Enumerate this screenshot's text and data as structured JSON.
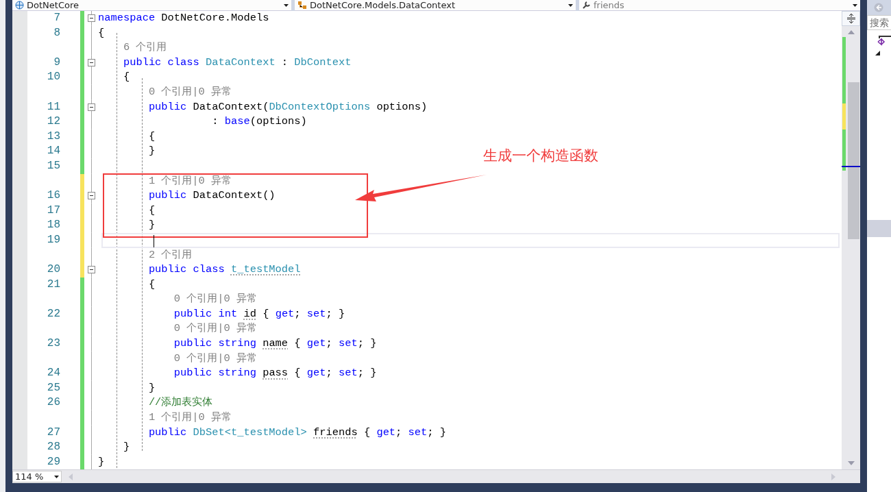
{
  "navigation_bar": [
    {
      "text": "DotNetCore",
      "dimmed": false
    },
    {
      "text": "DotNetCore.Models.DataContext",
      "dimmed": false
    },
    {
      "text": "friends",
      "dimmed": true
    }
  ],
  "lines": [
    {
      "kind": "code",
      "number": "7",
      "unsaved": false,
      "fold": true,
      "tokens": [
        {
          "kind": "keyword",
          "text": "namespace"
        },
        {
          "kind": "plain",
          "text": " DotNetCore.Models"
        }
      ]
    },
    {
      "kind": "code",
      "number": "8",
      "unsaved": false,
      "fold": false,
      "tokens": [
        {
          "kind": "plain",
          "text": "{"
        }
      ]
    },
    {
      "kind": "lens",
      "unsaved": false,
      "tokens": [
        {
          "kind": "lens",
          "text": "    6 个引用"
        }
      ]
    },
    {
      "kind": "code",
      "number": "9",
      "unsaved": false,
      "fold": true,
      "tokens": [
        {
          "kind": "keyword",
          "text": "    public class"
        },
        {
          "kind": "type",
          "text": " DataContext"
        },
        {
          "kind": "plain",
          "text": " : "
        },
        {
          "kind": "type",
          "text": "DbContext"
        }
      ]
    },
    {
      "kind": "code",
      "number": "10",
      "unsaved": false,
      "fold": false,
      "tokens": [
        {
          "kind": "plain",
          "text": "    {"
        }
      ]
    },
    {
      "kind": "lens",
      "unsaved": false,
      "tokens": [
        {
          "kind": "lens",
          "text": "        0 个引用|0 异常"
        }
      ]
    },
    {
      "kind": "code",
      "number": "11",
      "unsaved": false,
      "fold": true,
      "tokens": [
        {
          "kind": "keyword",
          "text": "        public"
        },
        {
          "kind": "plain",
          "text": " DataContext("
        },
        {
          "kind": "type",
          "text": "DbContextOptions"
        },
        {
          "kind": "plain",
          "text": " options)"
        }
      ]
    },
    {
      "kind": "code",
      "number": "12",
      "unsaved": false,
      "fold": false,
      "tokens": [
        {
          "kind": "plain",
          "text": "                  : "
        },
        {
          "kind": "keyword",
          "text": "base"
        },
        {
          "kind": "plain",
          "text": "(options)"
        }
      ]
    },
    {
      "kind": "code",
      "number": "13",
      "unsaved": false,
      "fold": false,
      "tokens": [
        {
          "kind": "plain",
          "text": "        {"
        }
      ]
    },
    {
      "kind": "code",
      "number": "14",
      "unsaved": false,
      "fold": false,
      "tokens": [
        {
          "kind": "plain",
          "text": "        }"
        }
      ]
    },
    {
      "kind": "code",
      "number": "15",
      "unsaved": false,
      "fold": false
    },
    {
      "kind": "lens",
      "unsaved": true,
      "tokens": [
        {
          "kind": "lens",
          "text": "        1 个引用|0 异常"
        }
      ]
    },
    {
      "kind": "code",
      "number": "16",
      "unsaved": true,
      "fold": true,
      "tokens": [
        {
          "kind": "keyword",
          "text": "        public"
        },
        {
          "kind": "plain",
          "text": " DataContext()"
        }
      ]
    },
    {
      "kind": "code",
      "number": "17",
      "unsaved": true,
      "fold": false,
      "tokens": [
        {
          "kind": "plain",
          "text": "        {"
        }
      ]
    },
    {
      "kind": "code",
      "number": "18",
      "unsaved": true,
      "fold": false,
      "tokens": [
        {
          "kind": "plain",
          "text": "        }"
        }
      ]
    },
    {
      "kind": "code",
      "number": "19",
      "unsaved": true,
      "fold": false,
      "current": true
    },
    {
      "kind": "lens",
      "unsaved": true,
      "tokens": [
        {
          "kind": "lens",
          "text": "        2 个引用"
        }
      ]
    },
    {
      "kind": "code",
      "number": "20",
      "unsaved": true,
      "fold": true,
      "tokens": [
        {
          "kind": "keyword",
          "text": "        public class "
        },
        {
          "kind": "type",
          "text": "t_testModel",
          "hint": true
        }
      ]
    },
    {
      "kind": "code",
      "number": "21",
      "unsaved": false,
      "fold": false,
      "tokens": [
        {
          "kind": "plain",
          "text": "        {"
        }
      ]
    },
    {
      "kind": "lens",
      "unsaved": false,
      "tokens": [
        {
          "kind": "lens",
          "text": "            0 个引用|0 异常"
        }
      ]
    },
    {
      "kind": "code",
      "number": "22",
      "unsaved": false,
      "fold": false,
      "tokens": [
        {
          "kind": "keyword",
          "text": "            public int "
        },
        {
          "kind": "plain",
          "text": "id",
          "hint": true
        },
        {
          "kind": "plain",
          "text": " { "
        },
        {
          "kind": "keyword",
          "text": "get"
        },
        {
          "kind": "plain",
          "text": "; "
        },
        {
          "kind": "keyword",
          "text": "set"
        },
        {
          "kind": "plain",
          "text": "; }"
        }
      ]
    },
    {
      "kind": "lens",
      "unsaved": false,
      "tokens": [
        {
          "kind": "lens",
          "text": "            0 个引用|0 异常"
        }
      ]
    },
    {
      "kind": "code",
      "number": "23",
      "unsaved": false,
      "fold": false,
      "tokens": [
        {
          "kind": "keyword",
          "text": "            public string "
        },
        {
          "kind": "plain",
          "text": "name",
          "hint": true
        },
        {
          "kind": "plain",
          "text": " { "
        },
        {
          "kind": "keyword",
          "text": "get"
        },
        {
          "kind": "plain",
          "text": "; "
        },
        {
          "kind": "keyword",
          "text": "set"
        },
        {
          "kind": "plain",
          "text": "; }"
        }
      ]
    },
    {
      "kind": "lens",
      "unsaved": false,
      "tokens": [
        {
          "kind": "lens",
          "text": "            0 个引用|0 异常"
        }
      ]
    },
    {
      "kind": "code",
      "number": "24",
      "unsaved": false,
      "fold": false,
      "tokens": [
        {
          "kind": "keyword",
          "text": "            public string "
        },
        {
          "kind": "plain",
          "text": "pass",
          "hint": true
        },
        {
          "kind": "plain",
          "text": " { "
        },
        {
          "kind": "keyword",
          "text": "get"
        },
        {
          "kind": "plain",
          "text": "; "
        },
        {
          "kind": "keyword",
          "text": "set"
        },
        {
          "kind": "plain",
          "text": "; }"
        }
      ]
    },
    {
      "kind": "code",
      "number": "25",
      "unsaved": false,
      "fold": false,
      "tokens": [
        {
          "kind": "plain",
          "text": "        }"
        }
      ]
    },
    {
      "kind": "code",
      "number": "26",
      "unsaved": false,
      "fold": false,
      "tokens": [
        {
          "kind": "comment",
          "text": "        //添加表实体"
        }
      ]
    },
    {
      "kind": "lens",
      "unsaved": false,
      "tokens": [
        {
          "kind": "lens",
          "text": "        1 个引用|0 异常"
        }
      ]
    },
    {
      "kind": "code",
      "number": "27",
      "unsaved": false,
      "fold": false,
      "tokens": [
        {
          "kind": "keyword",
          "text": "        public "
        },
        {
          "kind": "type",
          "text": "DbSet<t_testModel> "
        },
        {
          "kind": "plain",
          "text": "friends",
          "hint": true
        },
        {
          "kind": "plain",
          "text": " { "
        },
        {
          "kind": "keyword",
          "text": "get"
        },
        {
          "kind": "plain",
          "text": "; "
        },
        {
          "kind": "keyword",
          "text": "set"
        },
        {
          "kind": "plain",
          "text": "; }"
        }
      ]
    },
    {
      "kind": "code",
      "number": "28",
      "unsaved": false,
      "fold": false,
      "tokens": [
        {
          "kind": "plain",
          "text": "    }"
        }
      ]
    },
    {
      "kind": "code",
      "number": "29",
      "unsaved": false,
      "fold": false,
      "tokens": [
        {
          "kind": "plain",
          "text": "}"
        }
      ]
    }
  ],
  "annotation": {
    "text": "生成一个构造函数"
  },
  "zoom": {
    "value": "114 %"
  },
  "side_panel": {
    "search": {
      "placeholder": "搜索"
    }
  }
}
